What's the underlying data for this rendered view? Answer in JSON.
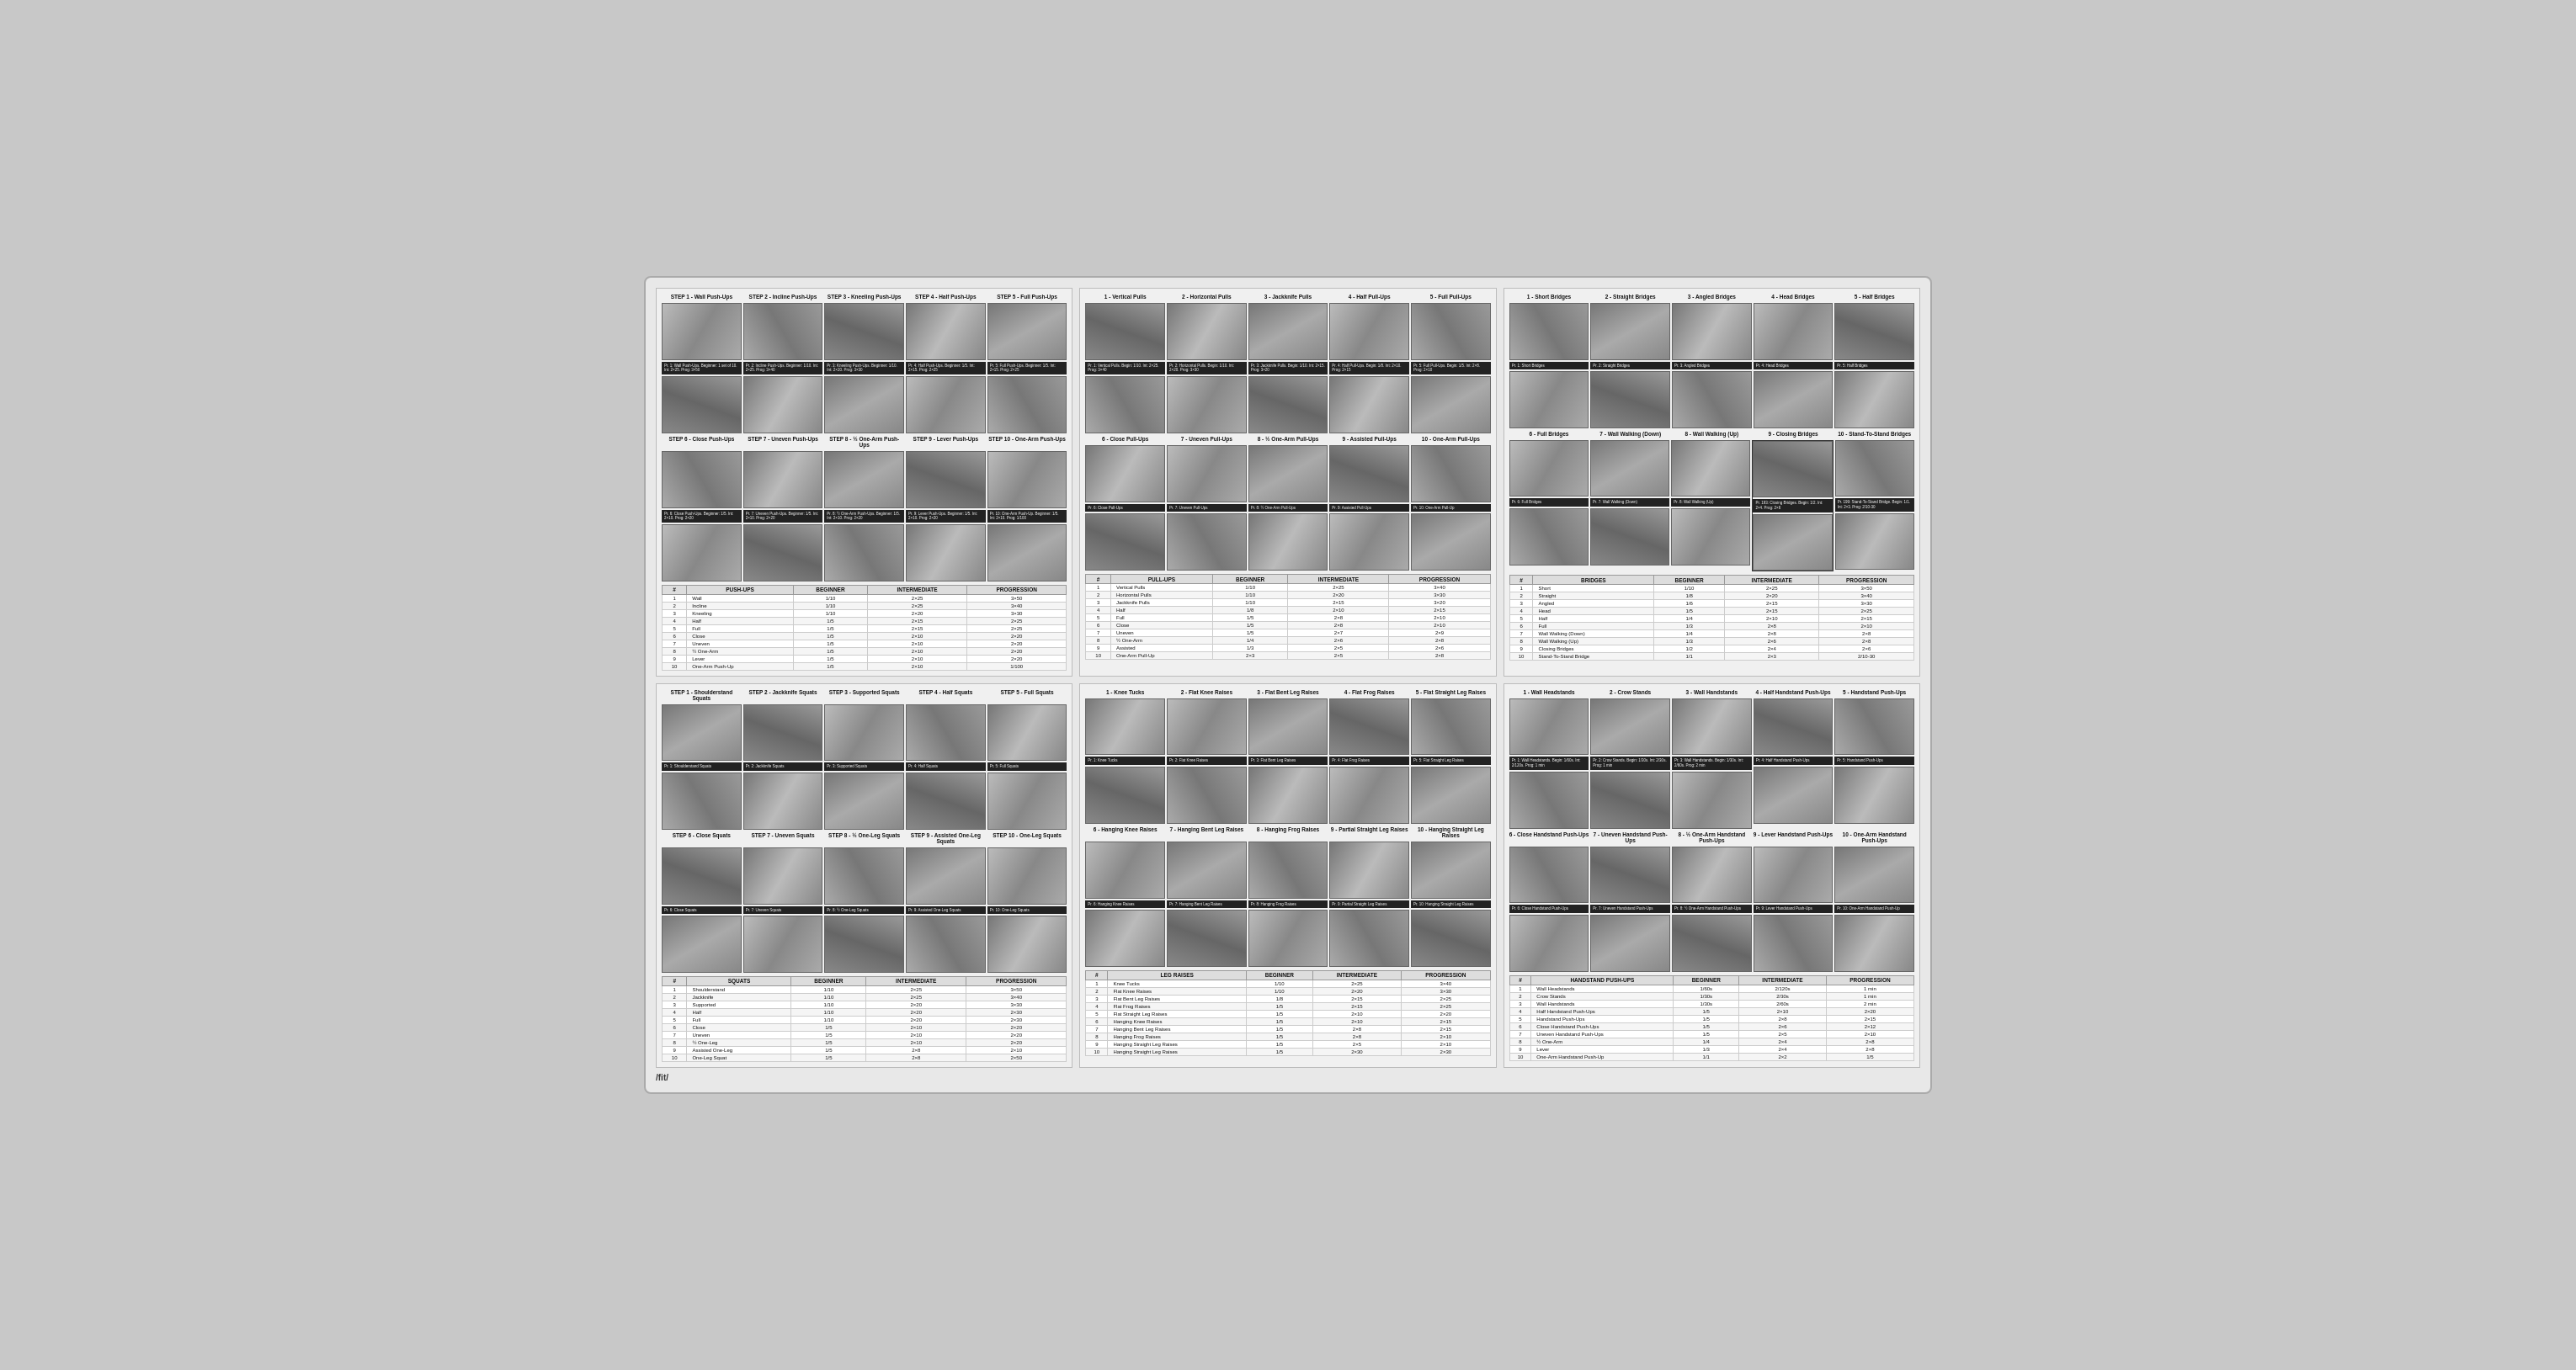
{
  "page": {
    "footer": "/fit/"
  },
  "pushups": {
    "title": "PUSH-UPS",
    "steps_row1": [
      {
        "label": "STEP 1 - Wall Push-Ups",
        "note": "Pr. 1"
      },
      {
        "label": "STEP 2 - Incline Push-Ups",
        "note": "Pr. 2"
      },
      {
        "label": "STEP 3 - Kneeling Push-Ups",
        "note": "Pr. 3"
      },
      {
        "label": "STEP 4 - Half Push-Ups",
        "note": "Pr. 4"
      },
      {
        "label": "STEP 5 - Full Push-Ups",
        "note": "Pr. 5"
      }
    ],
    "steps_row2": [
      {
        "label": "STEP 6 - Close Push-Ups",
        "note": "Pr. 6"
      },
      {
        "label": "STEP 7 - Uneven Push-Ups",
        "note": "Pr. 7"
      },
      {
        "label": "STEP 8 - ½ One-Arm Push-Ups",
        "note": "Pr. 8"
      },
      {
        "label": "STEP 9 - Lever Push-Ups",
        "note": "Pr. 9"
      },
      {
        "label": "STEP 10 - One-Arm Push-Ups",
        "note": "Pr. 10"
      }
    ],
    "table_headers": [
      "#",
      "PUSH-UPS",
      "BEGINNER",
      "INTERMEDIATE",
      "PROGRESSION"
    ],
    "table_rows": [
      [
        "1",
        "Wall",
        "1/10",
        "2×25",
        "3×50"
      ],
      [
        "2",
        "Incline",
        "1/10",
        "2×25",
        "3×40"
      ],
      [
        "3",
        "Kneeling",
        "1/10",
        "2×20",
        "3×30"
      ],
      [
        "4",
        "Half",
        "1/5",
        "2×15",
        "2×25"
      ],
      [
        "5",
        "Full",
        "1/5",
        "2×15",
        "2×25"
      ],
      [
        "6",
        "Close",
        "1/5",
        "2×10",
        "2×20"
      ],
      [
        "7",
        "Uneven",
        "1/5",
        "2×10",
        "2×20"
      ],
      [
        "8",
        "½ One-Arm",
        "1/5",
        "2×10",
        "2×20"
      ],
      [
        "9",
        "Lever",
        "1/5",
        "2×10",
        "2×20"
      ],
      [
        "10",
        "One-Arm Push-Up",
        "1/5",
        "2×10",
        "1/100"
      ]
    ]
  },
  "pullups": {
    "title": "PULL-UPS",
    "steps_row1": [
      {
        "label": "1 - Vertical Pulls",
        "note": "Pr. 1"
      },
      {
        "label": "2 - Horizontal Pulls",
        "note": "Pr. 2"
      },
      {
        "label": "3 - Jackknife Pulls",
        "note": "Pr. 3"
      },
      {
        "label": "4 - Half Pull-Ups",
        "note": "Pr. 4"
      },
      {
        "label": "5 - Full Pull-Ups",
        "note": "Pr. 5"
      }
    ],
    "steps_row2": [
      {
        "label": "6 - Close Pull-Ups",
        "note": "Pr. 6"
      },
      {
        "label": "7 - Uneven Pull-Ups",
        "note": "Pr. 7"
      },
      {
        "label": "8 - ½ One-Arm Pull-Ups",
        "note": "Pr. 8"
      },
      {
        "label": "9 - Assisted Pull-Ups",
        "note": "Pr. 9"
      },
      {
        "label": "10 - One-Arm Pull-Ups",
        "note": "Pr. 10"
      }
    ],
    "table_headers": [
      "#",
      "PULL-UPS",
      "BEGINNER",
      "INTERMEDIATE",
      "PROGRESSION"
    ],
    "table_rows": [
      [
        "1",
        "Vertical Pulls",
        "1/10",
        "2×25",
        "3×40"
      ],
      [
        "2",
        "Horizontal Pulls",
        "1/10",
        "2×20",
        "3×30"
      ],
      [
        "3",
        "Jackknife Pulls",
        "1/10",
        "2×15",
        "3×20"
      ],
      [
        "4",
        "Half",
        "1/8",
        "2×10",
        "2×15"
      ],
      [
        "5",
        "Full",
        "1/5",
        "2×8",
        "2×10"
      ],
      [
        "6",
        "Close",
        "1/5",
        "2×8",
        "2×10"
      ],
      [
        "7",
        "Uneven",
        "1/5",
        "2×7",
        "2×9"
      ],
      [
        "8",
        "½ One-Arm",
        "1/4",
        "2×6",
        "2×8"
      ],
      [
        "9",
        "Assisted",
        "1/3",
        "2×5",
        "2×6"
      ],
      [
        "10",
        "One-Arm Pull-Up",
        "2×3",
        "2×5",
        "2×8"
      ]
    ]
  },
  "bridges": {
    "title": "BRIDGES",
    "steps_row1": [
      {
        "label": "1 - Short Bridges",
        "note": "Pr. 1"
      },
      {
        "label": "2 - Straight Bridges",
        "note": "Pr. 2"
      },
      {
        "label": "3 - Angled Bridges",
        "note": "Pr. 3"
      },
      {
        "label": "4 - Head Bridges",
        "note": "Pr. 4"
      },
      {
        "label": "5 - Half Bridges",
        "note": "Pr. 5"
      }
    ],
    "steps_row2": [
      {
        "label": "6 - Full Bridges",
        "note": "Pr. 6"
      },
      {
        "label": "7 - Wall Walking (Down)",
        "note": "Pr. 7"
      },
      {
        "label": "8 - Wall Walking (Up)",
        "note": "Pr. 8"
      },
      {
        "label": "9 - Closing Bridges",
        "note": "Pr. 9"
      },
      {
        "label": "10 - Stand-To-Stand Bridges",
        "note": "Pr. 10"
      }
    ],
    "table_headers": [
      "#",
      "BRIDGES",
      "BEGINNER",
      "INTERMEDIATE",
      "PROGRESSION"
    ],
    "table_rows": [
      [
        "1",
        "Short",
        "1/10",
        "2×25",
        "3×50"
      ],
      [
        "2",
        "Straight",
        "1/8",
        "2×20",
        "3×40"
      ],
      [
        "3",
        "Angled",
        "1/6",
        "2×15",
        "3×30"
      ],
      [
        "4",
        "Head",
        "1/5",
        "2×15",
        "2×25"
      ],
      [
        "5",
        "Half",
        "1/4",
        "2×10",
        "2×15"
      ],
      [
        "6",
        "Full",
        "1/3",
        "2×8",
        "2×10"
      ],
      [
        "7",
        "Wall Walking (Down)",
        "1/4",
        "2×8",
        "2×8"
      ],
      [
        "8",
        "Wall Walking (Up)",
        "1/3",
        "2×6",
        "2×8"
      ],
      [
        "9",
        "Closing Bridges",
        "1/2",
        "2×4",
        "2×6"
      ],
      [
        "10",
        "Stand-To-Stand Bridge",
        "1/1",
        "2×3",
        "2/10-30"
      ]
    ]
  },
  "squats": {
    "title": "SQUATS",
    "steps_row1": [
      {
        "label": "STEP 1 - Shoulderstand Squats",
        "note": "Pr. 1"
      },
      {
        "label": "STEP 2 - Jackknife Squats",
        "note": "Pr. 2"
      },
      {
        "label": "STEP 3 - Supported Squats",
        "note": "Pr. 3"
      },
      {
        "label": "STEP 4 - Half Squats",
        "note": "Pr. 4"
      },
      {
        "label": "STEP 5 - Full Squats",
        "note": "Pr. 5"
      }
    ],
    "steps_row2": [
      {
        "label": "STEP 6 - Close Squats",
        "note": "Pr. 6"
      },
      {
        "label": "STEP 7 - Uneven Squats",
        "note": "Pr. 7"
      },
      {
        "label": "STEP 8 - ½ One-Leg Squats",
        "note": "Pr. 8"
      },
      {
        "label": "STEP 9 - Assisted One-Leg Squats",
        "note": "Pr. 9"
      },
      {
        "label": "STEP 10 - One-Leg Squats",
        "note": "Pr. 10"
      }
    ],
    "table_headers": [
      "#",
      "SQUATS",
      "BEGINNER",
      "INTERMEDIATE",
      "PROGRESSION"
    ],
    "table_rows": [
      [
        "1",
        "Shoulderstand",
        "1/10",
        "2×25",
        "3×50"
      ],
      [
        "2",
        "Jackknife",
        "1/10",
        "2×25",
        "3×40"
      ],
      [
        "3",
        "Supported",
        "1/10",
        "2×20",
        "3×30"
      ],
      [
        "4",
        "Half",
        "1/10",
        "2×20",
        "2×30"
      ],
      [
        "5",
        "Full",
        "1/10",
        "2×20",
        "2×30"
      ],
      [
        "6",
        "Close",
        "1/5",
        "2×10",
        "2×20"
      ],
      [
        "7",
        "Uneven",
        "1/5",
        "2×10",
        "2×20"
      ],
      [
        "8",
        "½ One-Leg",
        "1/5",
        "2×10",
        "2×20"
      ],
      [
        "9",
        "Assisted One-Leg",
        "1/5",
        "2×8",
        "2×10"
      ],
      [
        "10",
        "One-Leg Squat",
        "1/5",
        "2×8",
        "2×50"
      ]
    ]
  },
  "legraises": {
    "title": "LEG RAISES",
    "steps_row1": [
      {
        "label": "1 - Knee Tucks",
        "note": "Pr. 1"
      },
      {
        "label": "2 - Flat Knee Raises",
        "note": "Pr. 2"
      },
      {
        "label": "3 - Flat Bent Leg Raises",
        "note": "Pr. 3"
      },
      {
        "label": "4 - Flat Frog Raises",
        "note": "Pr. 4"
      },
      {
        "label": "5 - Flat Straight Leg Raises",
        "note": "Pr. 5"
      }
    ],
    "steps_row2": [
      {
        "label": "6 - Hanging Knee Raises",
        "note": "Pr. 6"
      },
      {
        "label": "7 - Hanging Bent Leg Raises",
        "note": "Pr. 7"
      },
      {
        "label": "8 - Hanging Frog Raises",
        "note": "Pr. 8"
      },
      {
        "label": "9 - Partial Straight Leg Raises",
        "note": "Pr. 9"
      },
      {
        "label": "10 - Hanging Straight Leg Raises",
        "note": "Pr. 10"
      }
    ],
    "table_headers": [
      "#",
      "LEG RAISES",
      "BEGINNER",
      "INTERMEDIATE",
      "PROGRESSION"
    ],
    "table_rows": [
      [
        "1",
        "Knee Tucks",
        "1/10",
        "2×25",
        "3×40"
      ],
      [
        "2",
        "Flat Knee Raises",
        "1/10",
        "2×20",
        "3×30"
      ],
      [
        "3",
        "Flat Bent Leg Raises",
        "1/8",
        "2×15",
        "2×25"
      ],
      [
        "4",
        "Flat Frog Raises",
        "1/5",
        "2×15",
        "2×25"
      ],
      [
        "5",
        "Flat Straight Leg Raises",
        "1/5",
        "2×10",
        "2×20"
      ],
      [
        "6",
        "Hanging Knee Raises",
        "1/5",
        "2×10",
        "2×15"
      ],
      [
        "7",
        "Hanging Bent Leg Raises",
        "1/5",
        "2×8",
        "2×15"
      ],
      [
        "8",
        "Hanging Frog Raises",
        "1/5",
        "2×8",
        "2×10"
      ],
      [
        "9",
        "Hanging Straight Leg Raises",
        "1/5",
        "2×5",
        "2×10"
      ],
      [
        "10",
        "Hanging Straight Leg Raises",
        "1/5",
        "2×30",
        "2×30"
      ]
    ]
  },
  "handstandpushups": {
    "title": "HANDSTAND PUSH-UPS",
    "steps_row1": [
      {
        "label": "1 - Wall Headstands",
        "note": "Pr. 1"
      },
      {
        "label": "2 - Crow Stands",
        "note": "Pr. 2"
      },
      {
        "label": "3 - Wall Handstands",
        "note": "Pr. 3"
      },
      {
        "label": "4 - Half Handstand Push-Ups",
        "note": "Pr. 4"
      },
      {
        "label": "5 - Handstand Push-Ups",
        "note": "Pr. 5"
      }
    ],
    "steps_row2": [
      {
        "label": "6 - Close Handstand Push-Ups",
        "note": "Pr. 6"
      },
      {
        "label": "7 - Uneven Handstand Push-Ups",
        "note": "Pr. 7"
      },
      {
        "label": "8 - ½ One-Arm Handstand Push-Ups",
        "note": "Pr. 8"
      },
      {
        "label": "9 - Lever Handstand Push-Ups",
        "note": "Pr. 9"
      },
      {
        "label": "10 - One-Arm Handstand Push-Ups",
        "note": "Pr. 10"
      }
    ],
    "table_headers": [
      "#",
      "HANDSTAND PUSH-UPS",
      "BEGINNER",
      "INTERMEDIATE",
      "PROGRESSION"
    ],
    "table_rows": [
      [
        "1",
        "Wall Headstands",
        "1/60s",
        "2/120s",
        "1 min"
      ],
      [
        "2",
        "Crow Stands",
        "1/30s",
        "2/30s",
        "1 min"
      ],
      [
        "3",
        "Wall Handstands",
        "1/30s",
        "2/60s",
        "2 min"
      ],
      [
        "4",
        "Half Handstand Push-Ups",
        "1/5",
        "2×10",
        "2×20"
      ],
      [
        "5",
        "Handstand Push-Ups",
        "1/5",
        "2×8",
        "2×15"
      ],
      [
        "6",
        "Close Handstand Push-Ups",
        "1/5",
        "2×6",
        "2×12"
      ],
      [
        "7",
        "Uneven Handstand Push-Ups",
        "1/5",
        "2×5",
        "2×10"
      ],
      [
        "8",
        "½ One-Arm",
        "1/4",
        "2×4",
        "2×8"
      ],
      [
        "9",
        "Lever",
        "1/3",
        "2×4",
        "2×8"
      ],
      [
        "10",
        "One-Arm Handstand Push-Up",
        "1/1",
        "2×2",
        "1/5"
      ]
    ]
  }
}
